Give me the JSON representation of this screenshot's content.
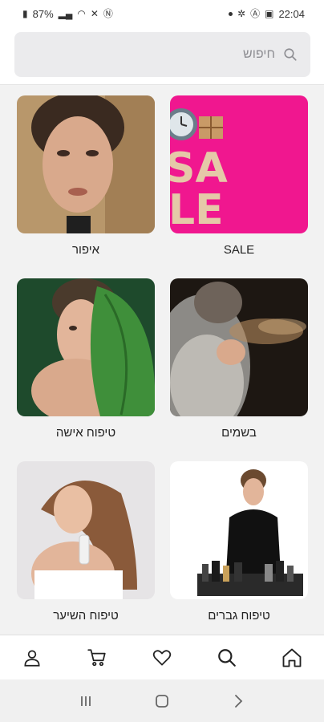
{
  "status_bar": {
    "battery": "87%",
    "time": "22:04"
  },
  "search": {
    "placeholder": "חיפוש",
    "icon": "search-icon"
  },
  "categories": [
    {
      "label": "SALE",
      "image": "sale-banner"
    },
    {
      "label": "איפור",
      "image": "makeup-woman"
    },
    {
      "label": "בשמים",
      "image": "perfume-spray"
    },
    {
      "label": "טיפוח אישה",
      "image": "woman-leaf"
    },
    {
      "label": "טיפוח גברים",
      "image": "man-grooming-products"
    },
    {
      "label": "טיפוח השיער",
      "image": "woman-hair"
    }
  ],
  "sale_image_text": {
    "top": "SA",
    "bottom": "LE"
  },
  "bottom_nav": [
    {
      "name": "home",
      "icon": "home-icon"
    },
    {
      "name": "search",
      "icon": "search-icon"
    },
    {
      "name": "wishlist",
      "icon": "heart-icon"
    },
    {
      "name": "cart",
      "icon": "cart-icon"
    },
    {
      "name": "account",
      "icon": "user-icon"
    }
  ],
  "colors": {
    "sale_pink": "#f0178f",
    "background": "#f2f2f2",
    "search_bg": "#ebebed"
  }
}
